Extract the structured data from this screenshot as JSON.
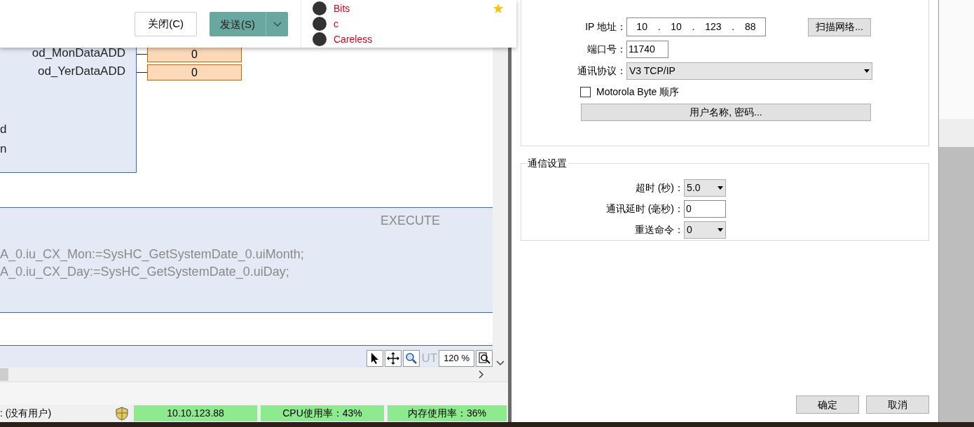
{
  "popup": {
    "buttons": [
      {
        "label": "关闭(C)",
        "kind": "secondary"
      },
      {
        "label": "发送(S)",
        "kind": "primary"
      }
    ],
    "contacts": [
      {
        "name": "Bits",
        "starred": true
      },
      {
        "name": "c",
        "starred": false
      },
      {
        "name": "Careless",
        "starred": false
      }
    ]
  },
  "function_block": {
    "outputs": [
      {
        "name": "od_MonDataADD",
        "value": "0"
      },
      {
        "name": "od_YerDataADD",
        "value": "0"
      }
    ],
    "partial_labels": [
      "d",
      "n"
    ]
  },
  "execute_section": {
    "title": "EXECUTE",
    "code_lines": [
      "A_0.iu_CX_Mon:=SysHC_GetSystemDate_0.uiMonth;",
      "A_0.iu_CX_Day:=SysHC_GetSystemDate_0.uiDay;"
    ]
  },
  "zoom_toolbar": {
    "cut_label": "UT",
    "zoom_level": "120 %"
  },
  "status_bar": {
    "user": ": (没有用户)",
    "cells": [
      "10.10.123.88",
      "CPU使用率：43%",
      "内存使用率：36%"
    ]
  },
  "dialog": {
    "connection": {
      "ip_label": "IP 地址：",
      "ip_parts": [
        "10",
        ".",
        "10",
        ".",
        "123",
        ".",
        "88"
      ],
      "scan_button": "扫描网络...",
      "port_label": "端口号：",
      "port": "11740",
      "protocol_label": "通讯协议：",
      "protocol": "V3 TCP/IP",
      "motorola": {
        "label": "Motorola Byte 顺序",
        "checked": false
      },
      "credentials_button": "用户名称, 密码..."
    },
    "comm_settings": {
      "title": "通信设置",
      "fields": [
        {
          "label": "超时 (秒)：",
          "value": "5.0",
          "kind": "dropdown"
        },
        {
          "label": "通讯延时 (毫秒)：",
          "value": "0",
          "kind": "input"
        },
        {
          "label": "重送命令：",
          "value": "0",
          "kind": "dropdown"
        }
      ]
    },
    "buttons": [
      "确定",
      "取消"
    ]
  }
}
